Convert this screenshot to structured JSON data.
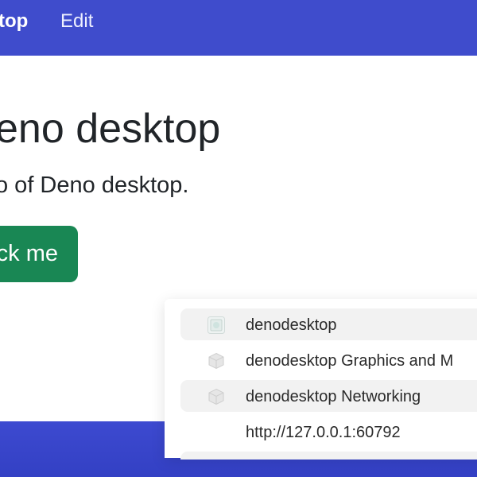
{
  "navbar": {
    "brand": "top",
    "edit_label": "Edit",
    "color": "#3f4ccc"
  },
  "hero": {
    "title": "eno desktop",
    "subtitle": "o of Deno desktop.",
    "button_label": "ck me",
    "button_color": "#198754"
  },
  "menu": {
    "items": [
      {
        "label": "denodesktop",
        "icon": "app-icon"
      },
      {
        "label": "denodesktop Graphics and M",
        "icon": "cube-icon"
      },
      {
        "label": "denodesktop Networking",
        "icon": "cube-icon"
      }
    ],
    "url": "http://127.0.0.1:60792"
  }
}
